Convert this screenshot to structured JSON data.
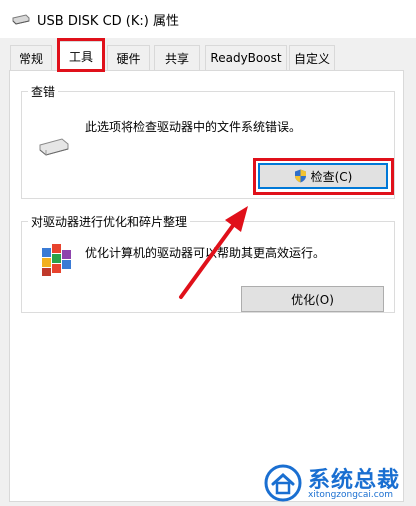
{
  "window": {
    "title": "USB DISK CD (K:) 属性",
    "icon": "usb-drive-icon"
  },
  "tabs": [
    {
      "label": "常规",
      "active": false
    },
    {
      "label": "工具",
      "active": true
    },
    {
      "label": "硬件",
      "active": false
    },
    {
      "label": "共享",
      "active": false
    },
    {
      "label": "ReadyBoost",
      "active": false
    },
    {
      "label": "自定义",
      "active": false
    }
  ],
  "error_check": {
    "title": "查错",
    "description": "此选项将检查驱动器中的文件系统错误。",
    "button_label": "检查(C)",
    "icon": "drive-icon",
    "button_icon": "uac-shield-icon"
  },
  "optimize": {
    "title": "对驱动器进行优化和碎片整理",
    "description": "优化计算机的驱动器可以帮助其更高效运行。",
    "button_label": "优化(O)",
    "icon": "defrag-icon"
  },
  "watermark": {
    "name": "系统总裁",
    "url": "xitongzongcai.com"
  },
  "colors": {
    "highlight": "#e0101a",
    "focus": "#0078d7",
    "brand": "#1a6fd1"
  }
}
